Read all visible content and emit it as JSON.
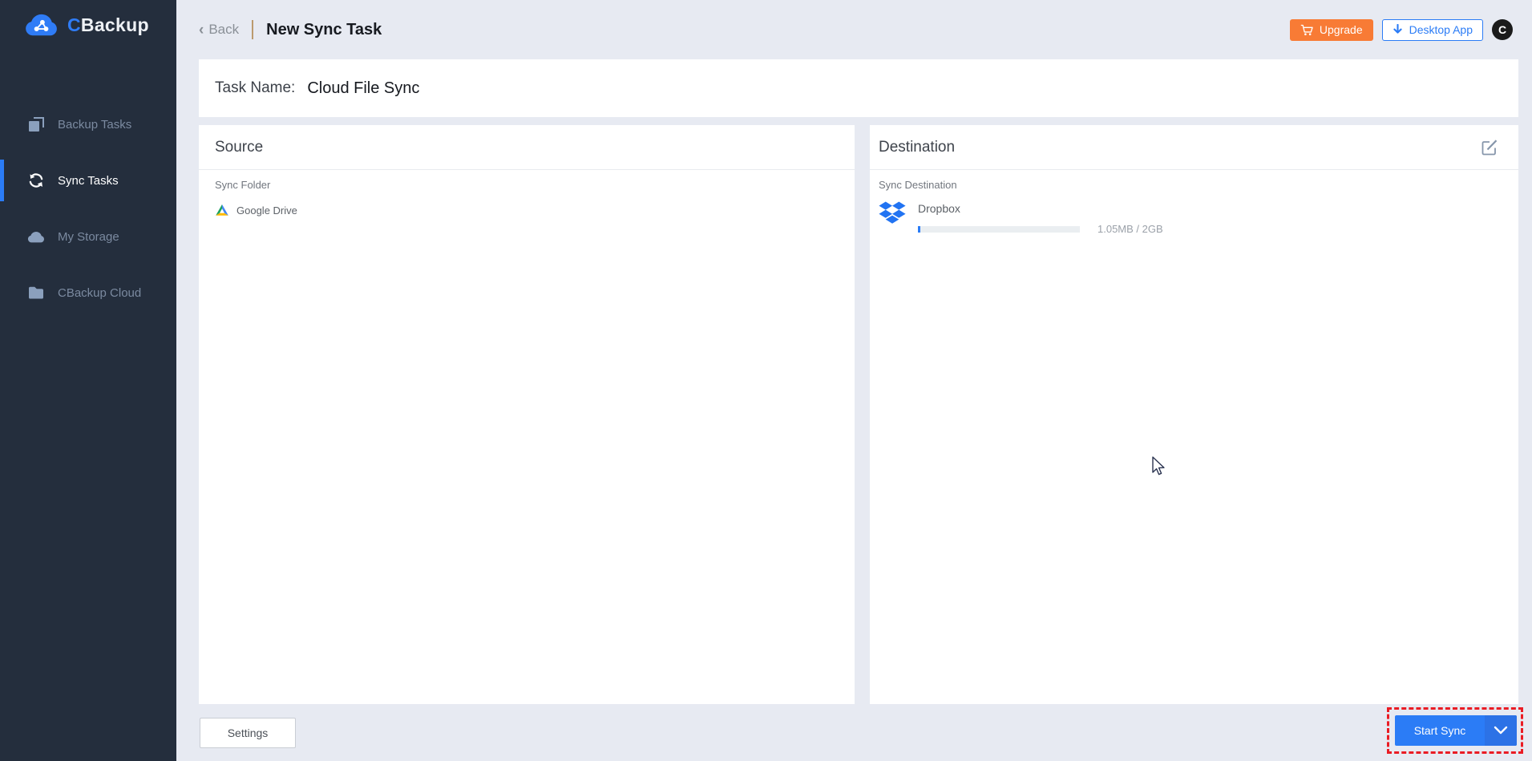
{
  "brand": {
    "c": "C",
    "rest": "Backup"
  },
  "sidebar": {
    "items": [
      {
        "label": "Backup Tasks"
      },
      {
        "label": "Sync Tasks"
      },
      {
        "label": "My Storage"
      },
      {
        "label": "CBackup Cloud"
      }
    ]
  },
  "topbar": {
    "back": "Back",
    "title": "New Sync Task",
    "upgrade": "Upgrade",
    "desktop_app": "Desktop App",
    "avatar_initial": "C"
  },
  "task": {
    "label": "Task Name:",
    "value": "Cloud File Sync"
  },
  "source": {
    "title": "Source",
    "section": "Sync Folder",
    "item": "Google Drive"
  },
  "destination": {
    "title": "Destination",
    "section": "Sync Destination",
    "provider": "Dropbox",
    "usage": "1.05MB / 2GB",
    "progress_width": "1.5%"
  },
  "footer": {
    "settings": "Settings",
    "start_sync": "Start Sync"
  },
  "colors": {
    "accent_blue": "#2b7cf6",
    "upgrade_orange": "#f87b35",
    "highlight_red": "#ea1c24",
    "sidebar_bg": "#242e3d",
    "page_bg": "#e7eaf2"
  }
}
